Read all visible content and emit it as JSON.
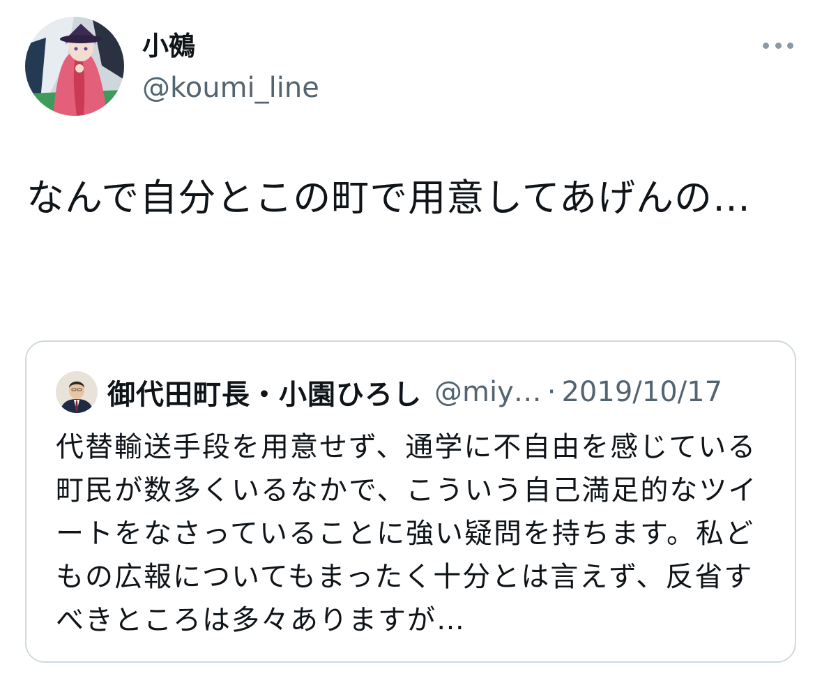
{
  "author": {
    "display_name": "小鵺",
    "handle": "@koumi_line",
    "avatar_icon": "avatar-anime-girl-icon"
  },
  "more_icon": "more-horizontal-icon",
  "tweet": {
    "text": "なんで自分とこの町で用意してあげんの…"
  },
  "quote": {
    "display_name": "御代田町長・小園ひろし",
    "handle": "@miy…",
    "separator": "·",
    "date": "2019/10/17",
    "avatar_icon": "avatar-man-in-suit-icon",
    "text": "代替輸送手段を用意せず、通学に不自由を感じている町民が数多くいるなかで、こういう自己満足的なツイートをなさっていることに強い疑問を持ちます。私どもの広報についてもまったく十分とは言えず、反省すべきところは多々ありますが…"
  },
  "colors": {
    "text_primary": "#0f1419",
    "text_secondary": "#536471",
    "border": "#cfd9de"
  }
}
